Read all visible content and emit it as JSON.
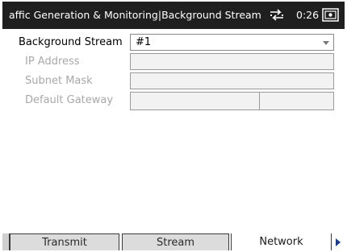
{
  "titlebar": {
    "title": "affic Generation & Monitoring|Background Stream",
    "time": "0:26",
    "network_icon": "network-activity-icon",
    "battery_icon": "battery-icon"
  },
  "form": {
    "background_stream": {
      "label": "Background Stream",
      "value": "#1"
    },
    "ip_address": {
      "label": "IP Address",
      "value": ""
    },
    "subnet_mask": {
      "label": "Subnet Mask",
      "value": ""
    },
    "default_gateway": {
      "label": "Default Gateway",
      "value": ""
    }
  },
  "tabs": [
    {
      "label": "Transmit",
      "active": false
    },
    {
      "label": "Stream",
      "active": false
    },
    {
      "label": "Network",
      "active": true
    }
  ],
  "colors": {
    "titlebar_bg": "#1f1f1f",
    "disabled_text": "#a8a8a8",
    "tab_bg": "#dcdcdc"
  }
}
